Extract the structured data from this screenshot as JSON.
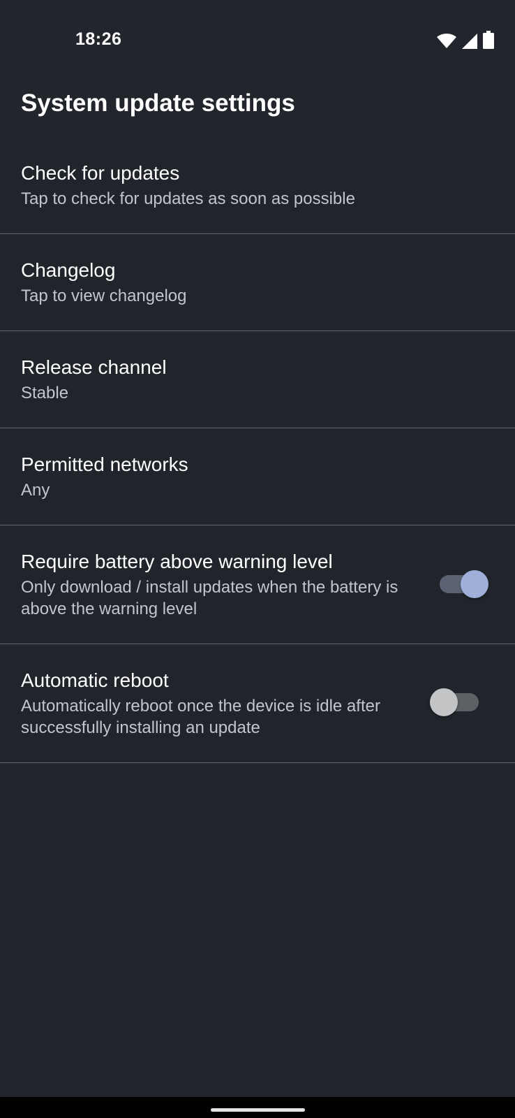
{
  "status_bar": {
    "time": "18:26",
    "icons": [
      "wifi-icon",
      "cellular-signal-icon",
      "battery-icon"
    ]
  },
  "header": {
    "title": "System update settings"
  },
  "preferences": [
    {
      "title": "Check for updates",
      "summary": "Tap to check for updates as soon as possible"
    },
    {
      "title": "Changelog",
      "summary": "Tap to view changelog"
    },
    {
      "title": "Release channel",
      "summary": "Stable"
    },
    {
      "title": "Permitted networks",
      "summary": "Any"
    },
    {
      "title": "Require battery above warning level",
      "summary": "Only download / install updates when the battery is above the warning level",
      "switch_on": true
    },
    {
      "title": "Automatic reboot",
      "summary": "Automatically reboot once the device is idle after successfully installing an update",
      "switch_on": false
    }
  ],
  "colors": {
    "background": "#21252b",
    "switch_on_thumb": "#9fb0d8",
    "switch_off_thumb": "#c3c4c6",
    "divider": "#62666c"
  }
}
